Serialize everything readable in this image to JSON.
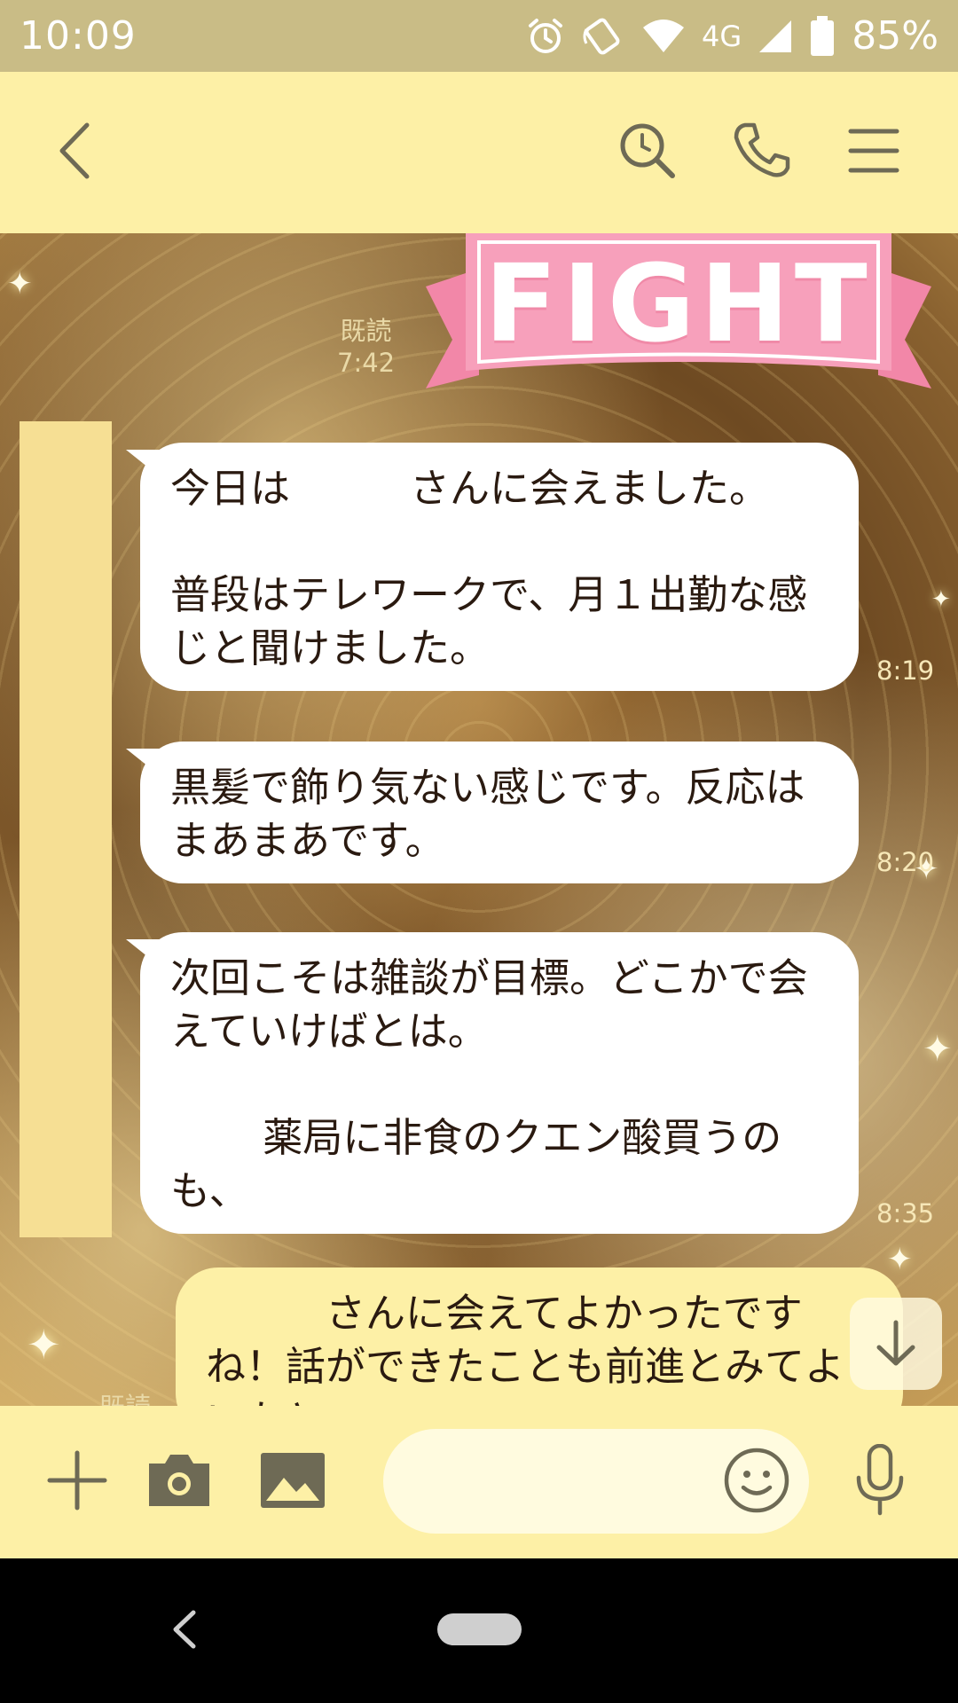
{
  "status_bar": {
    "time": "10:09",
    "network": "4G",
    "battery": "85%",
    "icons": [
      "alarm-icon",
      "nfc-icon",
      "wifi-icon",
      "signal-icon",
      "battery-icon"
    ]
  },
  "header": {
    "icons": [
      "chevron-left-icon",
      "search-history-icon",
      "phone-icon",
      "menu-icon"
    ]
  },
  "chat": {
    "sticker": {
      "text": "FIGHT"
    },
    "read_1": {
      "label": "既読",
      "time": "7:42"
    },
    "messages": [
      {
        "text": "今日は　　　さんに会えました。\n\n普段はテレワークで、月１出勤な感じと聞けました。",
        "time": "8:19"
      },
      {
        "text": "黒髪で飾り気ない感じです。反応はまあまあです。",
        "time": "8:20"
      },
      {
        "text": "次回こそは雑談が目標。どこかで会えていけばとは。\n\n　　 薬局に非食のクエン酸買うのも、",
        "time": "8:35"
      }
    ],
    "outgoing": {
      "text": "　　　さんに会えてよかったですね！話ができたことも前進とみてよいかと",
      "read_label": "既読"
    }
  },
  "input_bar": {
    "placeholder": "",
    "icons": [
      "plus-icon",
      "camera-icon",
      "image-icon",
      "emoji-icon",
      "mic-icon"
    ]
  },
  "colors": {
    "status_bar": "#c9bc86",
    "header": "#fdf0a6",
    "bubble_in": "#ffffff",
    "bubble_out": "#fdf0a6",
    "icon": "#6e6a55"
  }
}
